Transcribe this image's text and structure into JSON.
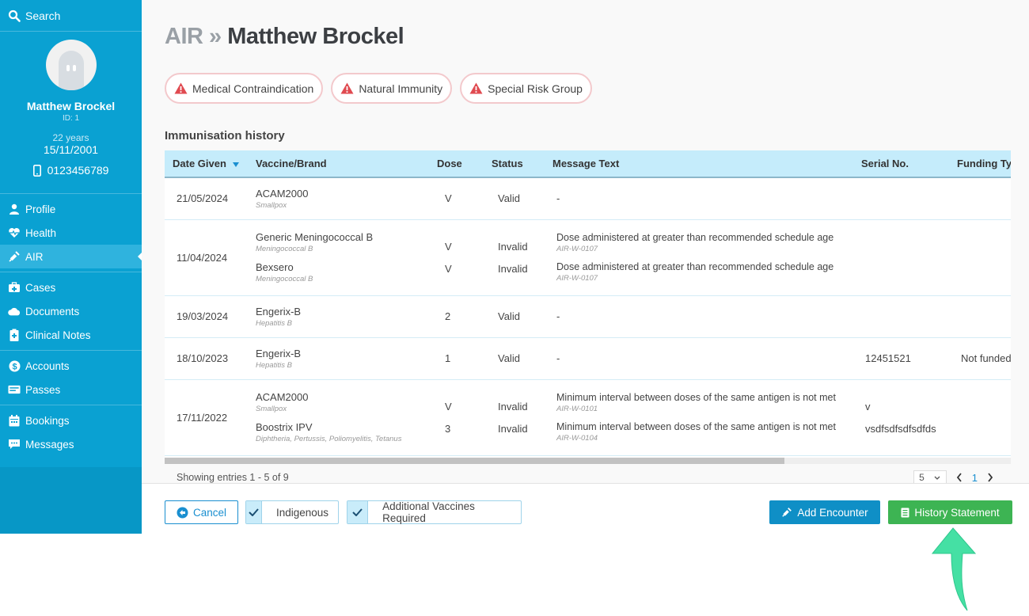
{
  "sidebar": {
    "search_label": "Search",
    "patient": {
      "name": "Matthew Brockel",
      "id": "ID: 1",
      "age": "22 years",
      "dob": "15/11/2001",
      "phone": "0123456789"
    },
    "nav_groups": [
      [
        {
          "label": "Profile",
          "icon": "user-icon"
        },
        {
          "label": "Health",
          "icon": "heart-pulse-icon"
        },
        {
          "label": "AIR",
          "icon": "syringe-icon",
          "active": true
        }
      ],
      [
        {
          "label": "Cases",
          "icon": "medical-kit-icon"
        },
        {
          "label": "Documents",
          "icon": "cloud-icon"
        },
        {
          "label": "Clinical Notes",
          "icon": "clipboard-medical-icon"
        }
      ],
      [
        {
          "label": "Accounts",
          "icon": "dollar-icon"
        },
        {
          "label": "Passes",
          "icon": "card-icon"
        }
      ],
      [
        {
          "label": "Bookings",
          "icon": "calendar-icon"
        },
        {
          "label": "Messages",
          "icon": "chat-icon"
        }
      ]
    ]
  },
  "header": {
    "crumb": "AIR »",
    "title": "Matthew Brockel"
  },
  "alerts": [
    "Medical Contraindication",
    "Natural Immunity",
    "Special Risk Group"
  ],
  "section_title": "Immunisation history",
  "table": {
    "columns": [
      "Date Given",
      "Vaccine/Brand",
      "Dose",
      "Status",
      "Message Text",
      "Serial No.",
      "Funding Type"
    ],
    "rows": [
      {
        "date": "21/05/2024",
        "items": [
          {
            "vaccine": "ACAM2000",
            "sub": "Smallpox",
            "dose": "V",
            "status": "Valid",
            "message": "-",
            "code": "",
            "serial": "",
            "funding": ""
          }
        ]
      },
      {
        "date": "11/04/2024",
        "items": [
          {
            "vaccine": "Generic Meningococcal B",
            "sub": "Meningococcal B",
            "dose": "V",
            "status": "Invalid",
            "message": "Dose administered at greater than recommended schedule age",
            "code": "AIR-W-0107",
            "serial": "",
            "funding": ""
          },
          {
            "vaccine": "Bexsero",
            "sub": "Meningococcal B",
            "dose": "V",
            "status": "Invalid",
            "message": "Dose administered at greater than recommended schedule age",
            "code": "AIR-W-0107",
            "serial": "",
            "funding": ""
          }
        ]
      },
      {
        "date": "19/03/2024",
        "items": [
          {
            "vaccine": "Engerix-B",
            "sub": "Hepatitis B",
            "dose": "2",
            "status": "Valid",
            "message": "-",
            "code": "",
            "serial": "",
            "funding": ""
          }
        ]
      },
      {
        "date": "18/10/2023",
        "items": [
          {
            "vaccine": "Engerix-B",
            "sub": "Hepatitis B",
            "dose": "1",
            "status": "Valid",
            "message": "-",
            "code": "",
            "serial": "12451521",
            "funding": "Not funded"
          }
        ]
      },
      {
        "date": "17/11/2022",
        "items": [
          {
            "vaccine": "ACAM2000",
            "sub": "Smallpox",
            "dose": "V",
            "status": "Invalid",
            "message": "Minimum interval between doses of the same antigen is not met",
            "code": "AIR-W-0101",
            "serial": "v",
            "funding": ""
          },
          {
            "vaccine": "Boostrix IPV",
            "sub": "Diphtheria, Pertussis, Poliomyelitis, Tetanus",
            "dose": "3",
            "status": "Invalid",
            "message": "Minimum interval between doses of the same antigen is not met",
            "code": "AIR-W-0104",
            "serial": "vsdfsdfsdfsdfds",
            "funding": ""
          }
        ]
      }
    ]
  },
  "pagination": {
    "summary": "Showing entries 1 - 5 of 9",
    "page_size": "5",
    "current_page": "1"
  },
  "actions": {
    "cancel": "Cancel",
    "indigenous": "Indigenous",
    "additional": "Additional Vaccines Required",
    "add_encounter": "Add Encounter",
    "history_statement": "History Statement"
  },
  "colors": {
    "sidebar": "#0aa1d2",
    "table_header": "#c5ecfb",
    "primary": "#0f8fc6",
    "success": "#3db453",
    "alert": "#e04a50",
    "annotation_arrow": "#45e0a4"
  }
}
